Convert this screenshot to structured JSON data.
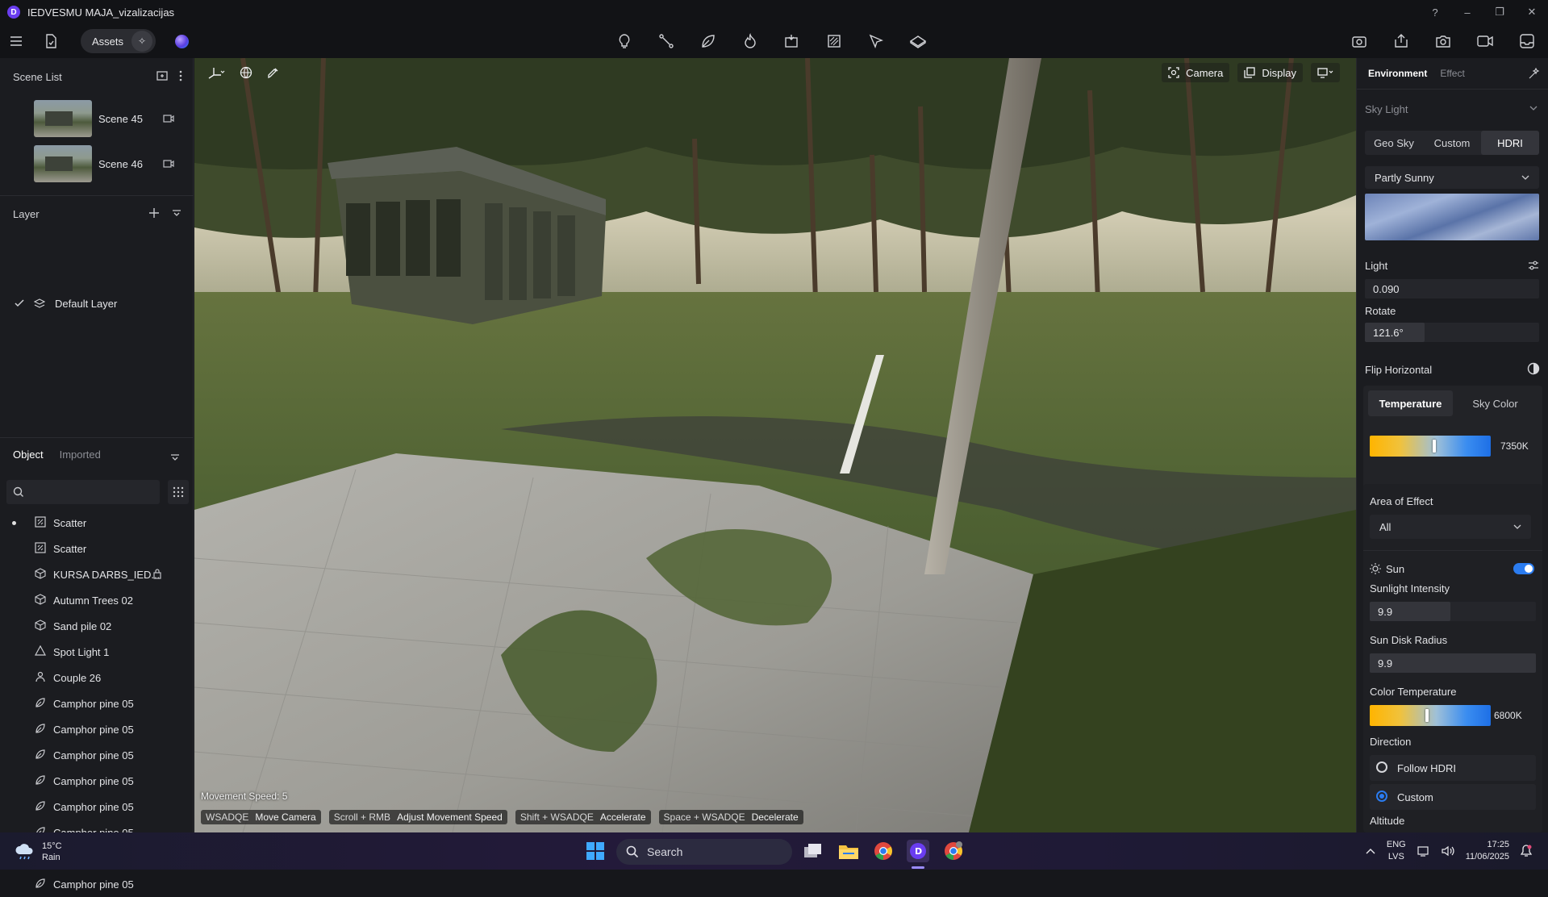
{
  "window": {
    "title": "IEDVESMU MAJA_vizalizacijas",
    "controls": [
      "?",
      "–",
      "❐",
      "✕"
    ]
  },
  "toolbar": {
    "assets_label": "Assets"
  },
  "scene_list": {
    "title": "Scene List",
    "scenes": [
      {
        "name": "Scene 45"
      },
      {
        "name": "Scene 46"
      }
    ]
  },
  "layer": {
    "title": "Layer",
    "items": [
      {
        "name": "Default Layer"
      }
    ]
  },
  "objects": {
    "tabs": [
      "Object",
      "Imported"
    ],
    "search_placeholder": "",
    "items": [
      {
        "name": "Scatter",
        "icon": "scatter-icon",
        "active": true
      },
      {
        "name": "Scatter",
        "icon": "scatter-icon"
      },
      {
        "name": "KURSA DARBS_IED...",
        "icon": "model-icon",
        "locked": true
      },
      {
        "name": "Autumn Trees 02",
        "icon": "model-icon"
      },
      {
        "name": "Sand pile 02",
        "icon": "model-icon"
      },
      {
        "name": "Spot Light 1",
        "icon": "spotlight-icon"
      },
      {
        "name": "Couple 26",
        "icon": "person-icon"
      },
      {
        "name": "Camphor pine 05",
        "icon": "leaf-icon"
      },
      {
        "name": "Camphor pine 05",
        "icon": "leaf-icon"
      },
      {
        "name": "Camphor pine 05",
        "icon": "leaf-icon"
      },
      {
        "name": "Camphor pine 05",
        "icon": "leaf-icon"
      },
      {
        "name": "Camphor pine 05",
        "icon": "leaf-icon"
      },
      {
        "name": "Camphor pine 05",
        "icon": "leaf-icon"
      },
      {
        "name": "Camphor pine 05",
        "icon": "leaf-icon"
      },
      {
        "name": "Camphor pine 05",
        "icon": "leaf-icon"
      }
    ]
  },
  "viewport": {
    "camera_label": "Camera",
    "display_label": "Display",
    "movement_speed": "Movement Speed: 5",
    "hints": [
      {
        "key": "WSADQE",
        "action": "Move Camera"
      },
      {
        "key": "Scroll + RMB",
        "action": "Adjust Movement Speed"
      },
      {
        "key": "Shift + WSADQE",
        "action": "Accelerate"
      },
      {
        "key": "Space + WSADQE",
        "action": "Decelerate"
      }
    ]
  },
  "right_panel": {
    "tabs": [
      "Environment",
      "Effect"
    ],
    "sky_light_label": "Sky Light",
    "sky_modes": [
      "Geo Sky",
      "Custom",
      "HDRI"
    ],
    "sky_mode_selected": "HDRI",
    "hdri_preset": "Partly Sunny",
    "light_label": "Light",
    "light_value": "0.090",
    "rotate_label": "Rotate",
    "rotate_value": "121.6°",
    "flip_horizontal_label": "Flip Horizontal",
    "color_tabs": [
      "Temperature",
      "Sky Color"
    ],
    "temperature_value": "7350K",
    "temperature_fraction": 0.53,
    "area_of_effect_label": "Area of Effect",
    "area_of_effect_value": "All",
    "sun_label": "Sun",
    "sun_enabled": true,
    "sunlight_intensity_label": "Sunlight Intensity",
    "sunlight_intensity_value": "9.9",
    "sun_disk_radius_label": "Sun Disk Radius",
    "sun_disk_radius_value": "9.9",
    "color_temperature_label": "Color Temperature",
    "color_temperature_value": "6800K",
    "color_temperature_fraction": 0.47,
    "direction_label": "Direction",
    "direction_options": [
      "Follow HDRI",
      "Custom"
    ],
    "direction_selected": "Custom",
    "altitude_label": "Altitude"
  },
  "taskbar": {
    "weather_temp": "15°C",
    "weather_desc": "Rain",
    "search_label": "Search",
    "lang_top": "ENG",
    "lang_bottom": "LVS",
    "time": "17:25",
    "date": "11/06/2025"
  },
  "colors": {
    "accent": "#2b7cf0",
    "panel": "#1b1c20",
    "field": "#25262b"
  }
}
